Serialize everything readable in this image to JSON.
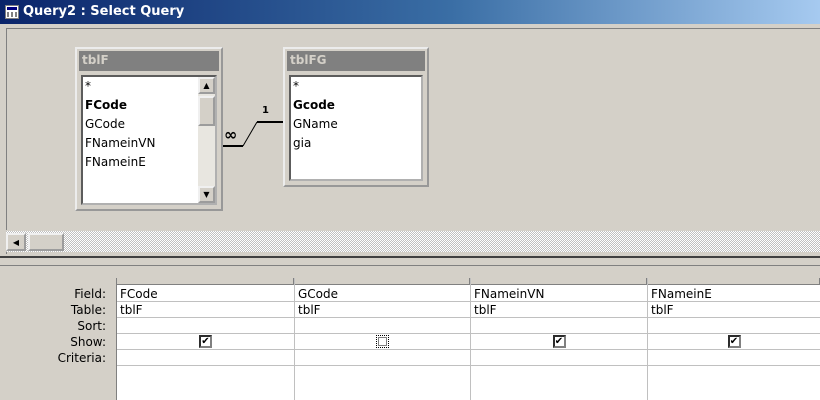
{
  "window": {
    "title": "Query2 : Select Query"
  },
  "tables": [
    {
      "name": "tblF",
      "fields": [
        {
          "name": "*",
          "primary_key": false
        },
        {
          "name": "FCode",
          "primary_key": true
        },
        {
          "name": "GCode",
          "primary_key": false
        },
        {
          "name": "FNameinVN",
          "primary_key": false
        },
        {
          "name": "FNameinE",
          "primary_key": false
        }
      ]
    },
    {
      "name": "tblFG",
      "fields": [
        {
          "name": "*",
          "primary_key": false
        },
        {
          "name": "Gcode",
          "primary_key": true
        },
        {
          "name": "GName",
          "primary_key": false
        },
        {
          "name": "gia",
          "primary_key": false
        }
      ]
    }
  ],
  "relationship": {
    "many_side_label": "∞",
    "one_side_label": "1"
  },
  "grid": {
    "row_labels": {
      "field": "Field:",
      "table": "Table:",
      "sort": "Sort:",
      "show": "Show:",
      "criteria": "Criteria:"
    },
    "columns": [
      {
        "field": "FCode",
        "table": "tblF",
        "sort": "",
        "show": true,
        "criteria": ""
      },
      {
        "field": "GCode",
        "table": "tblF",
        "sort": "",
        "show": false,
        "criteria": ""
      },
      {
        "field": "FNameinVN",
        "table": "tblF",
        "sort": "",
        "show": true,
        "criteria": ""
      },
      {
        "field": "FNameinE",
        "table": "tblF",
        "sort": "",
        "show": true,
        "criteria": ""
      }
    ]
  },
  "icons": {
    "app": "query-window-icon",
    "scroll_up": "scroll-up-arrow-icon",
    "scroll_down": "scroll-down-arrow-icon",
    "scroll_left": "scroll-left-arrow-icon",
    "check": "checkmark-icon"
  }
}
